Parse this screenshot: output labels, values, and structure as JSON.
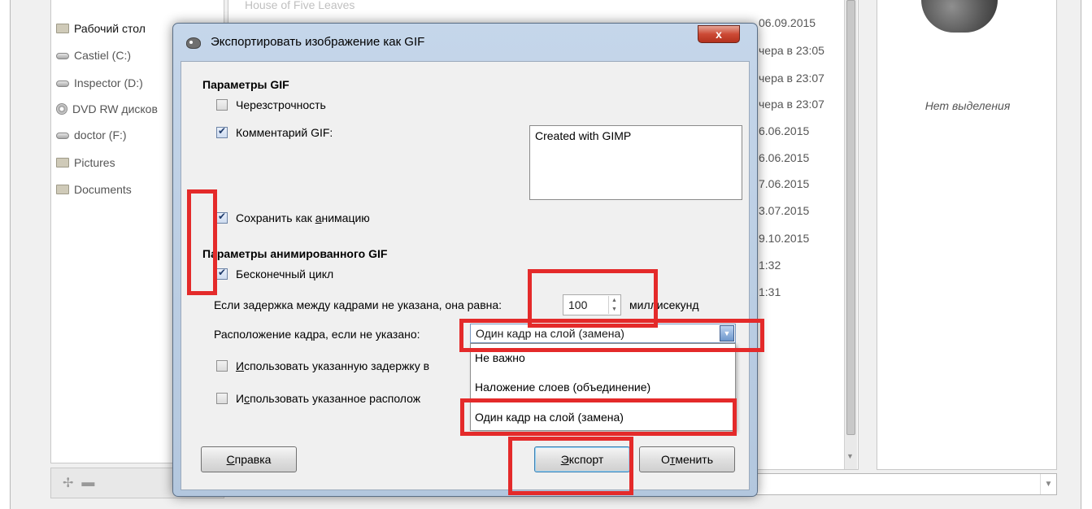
{
  "file_chooser": {
    "places": [
      {
        "label": "Рабочий стол",
        "icon": "folder-icon"
      },
      {
        "label": "Castiel (C:)",
        "icon": "drive-icon"
      },
      {
        "label": "Inspector (D:)",
        "icon": "drive-icon"
      },
      {
        "label": "DVD RW дисков",
        "icon": "disc-drive-icon"
      },
      {
        "label": "doctor (F:)",
        "icon": "drive-icon"
      },
      {
        "label": "Pictures",
        "icon": "folder-icon"
      },
      {
        "label": "Documents",
        "icon": "folder-icon"
      }
    ],
    "places_toolbar": {
      "add_icon": "add-icon",
      "remove_icon": "remove-icon"
    },
    "files": {
      "first_name": "House of Five Leaves",
      "modified": [
        "06.09.2015",
        "чера в 23:05",
        "чера в 23:07",
        "чера в 23:07",
        "6.06.2015",
        "6.06.2015",
        "7.06.2015",
        "3.07.2015",
        "9.10.2015",
        "1:32",
        "1:31"
      ]
    },
    "preview": {
      "no_selection": "Нет выделения",
      "icon": "gimp-wilber-icon"
    }
  },
  "dialog": {
    "title": "Экспортировать изображение как GIF",
    "close_label": "x",
    "gif_params": {
      "header": "Параметры GIF",
      "interlace_label": "Черезстрочность",
      "interlace_checked": false,
      "comment_label": "Комментарий GIF:",
      "comment_checked": true,
      "comment_text": "Created with GIMP"
    },
    "save_anim": {
      "label_before": "Сохранить как ",
      "label_underlined": "а",
      "label_after": "нимацию",
      "checked": true
    },
    "anim_params": {
      "header": "Параметры анимированного GIF",
      "loop_label": "Бесконечный цикл",
      "loop_checked": true,
      "delay_label": "Если задержка между кадрами не указана, она равна:",
      "delay_value": "100",
      "delay_unit": "миллисекунд",
      "disposal_label": "Расположение кадра, если не указано:",
      "disposal_value": "Один кадр на слой (замена)",
      "disposal_options": [
        "Не важно",
        "Наложение слоев (объединение)",
        "Один кадр на слой (замена)"
      ],
      "use_delay_underlined": "И",
      "use_delay_rest": "спользовать указанную задержку в",
      "use_delay_checked": false,
      "use_disposal_first": "И",
      "use_disposal_underlined": "с",
      "use_disposal_rest": "пользовать указанное располож",
      "use_disposal_checked": false
    },
    "buttons": {
      "help_underlined": "С",
      "help_rest": "правка",
      "export_underlined": "Э",
      "export_rest": "кспорт",
      "cancel_first": "О",
      "cancel_underlined": "т",
      "cancel_rest": "менить"
    }
  },
  "colors": {
    "highlight": "#e42a2a",
    "titlebar": "#c5d6ea",
    "close_button": "#cc4a35"
  }
}
